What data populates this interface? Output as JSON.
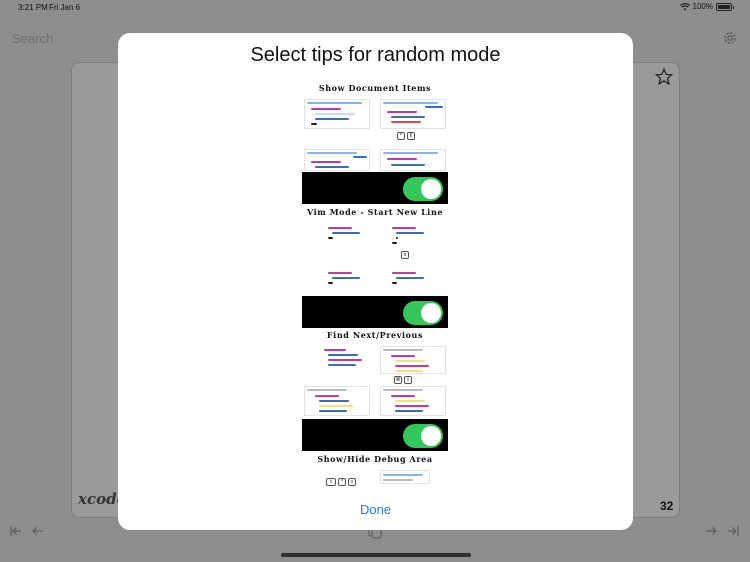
{
  "status_bar": {
    "time": "3:21 PM",
    "date": "Fri Jan 6",
    "battery": "100%",
    "battery_level": 1.0
  },
  "search": {
    "placeholder": "Search"
  },
  "card": {
    "brand": "xcode",
    "count": "32"
  },
  "modal": {
    "title": "Select tips for random mode",
    "done_label": "Done",
    "tips": [
      {
        "title": "Show Document Items",
        "enabled": true
      },
      {
        "title": "Vim Mode - Start New Line",
        "enabled": true
      },
      {
        "title": "Find Next/Previous",
        "enabled": true
      },
      {
        "title": "Show/Hide Debug Area",
        "enabled": true
      }
    ]
  },
  "colors": {
    "accent": "#1f7fe0",
    "toggle_on": "#34c759",
    "dim_background": "#8e8e8e"
  },
  "icons": {
    "wifi": "wifi-icon",
    "battery": "battery-icon",
    "settings": "gear-icon",
    "favorite": "star-icon",
    "first": "skip-back-icon",
    "previous": "arrow-left-icon",
    "shuffle": "shuffle-icon",
    "next": "arrow-right-icon",
    "last": "skip-forward-icon"
  }
}
